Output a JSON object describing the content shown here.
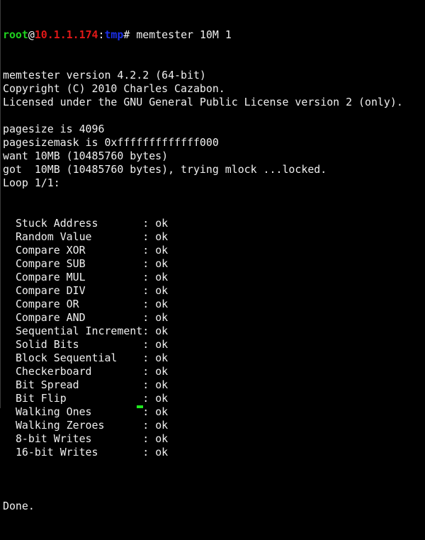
{
  "prompt": {
    "user": "root",
    "at": "@",
    "host": "10.1.1.174",
    "colon": ":",
    "path": "tmp",
    "symbol": "# ",
    "command": "memtester 10M 1"
  },
  "colors": {
    "user": "#1fd11f",
    "host": "#e01818",
    "path": "#1b2fe8",
    "text": "#f0f0f0",
    "background": "#000000",
    "cursor": "#1fe81f"
  },
  "header_lines": [
    "memtester version 4.2.2 (64-bit)",
    "Copyright (C) 2010 Charles Cazabon.",
    "Licensed under the GNU General Public License version 2 (only).",
    "",
    "pagesize is 4096",
    "pagesizemask is 0xfffffffffffff000",
    "want 10MB (10485760 bytes)",
    "got  10MB (10485760 bytes), trying mlock ...locked.",
    "Loop 1/1:"
  ],
  "tests": [
    {
      "name": "Stuck Address",
      "result": "ok"
    },
    {
      "name": "Random Value",
      "result": "ok"
    },
    {
      "name": "Compare XOR",
      "result": "ok"
    },
    {
      "name": "Compare SUB",
      "result": "ok"
    },
    {
      "name": "Compare MUL",
      "result": "ok"
    },
    {
      "name": "Compare DIV",
      "result": "ok"
    },
    {
      "name": "Compare OR",
      "result": "ok"
    },
    {
      "name": "Compare AND",
      "result": "ok"
    },
    {
      "name": "Sequential Increment",
      "result": "ok"
    },
    {
      "name": "Solid Bits",
      "result": "ok"
    },
    {
      "name": "Block Sequential",
      "result": "ok"
    },
    {
      "name": "Checkerboard",
      "result": "ok"
    },
    {
      "name": "Bit Spread",
      "result": "ok"
    },
    {
      "name": "Bit Flip",
      "result": "ok"
    },
    {
      "name": "Walking Ones",
      "result": "ok"
    },
    {
      "name": "Walking Zeroes",
      "result": "ok"
    },
    {
      "name": "8-bit Writes",
      "result": "ok"
    },
    {
      "name": "16-bit Writes",
      "result": "ok"
    }
  ],
  "footer_lines": [
    "",
    "Done."
  ]
}
